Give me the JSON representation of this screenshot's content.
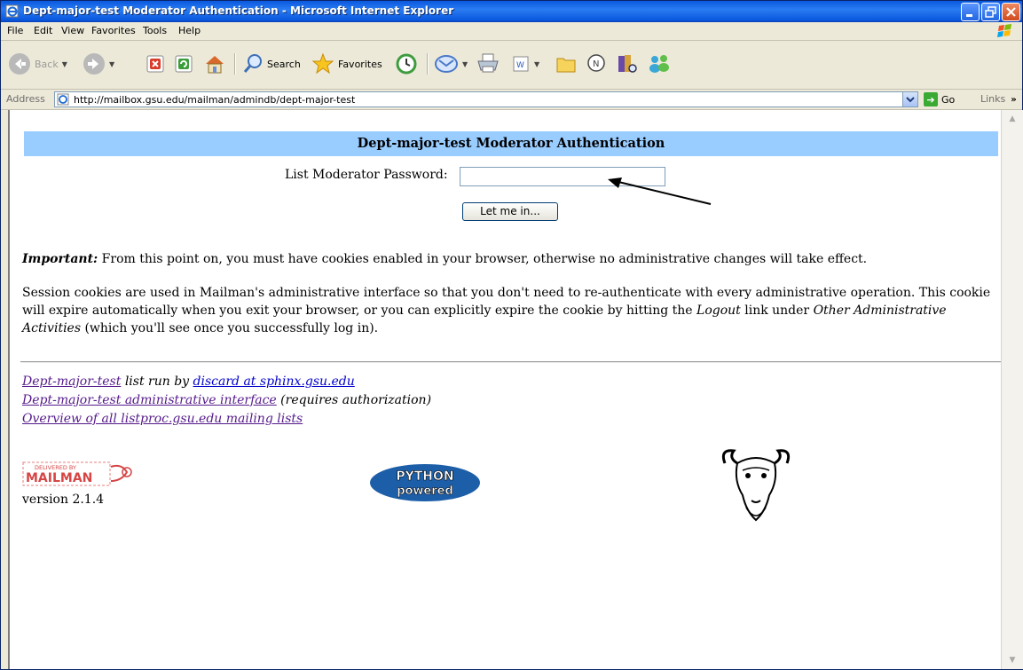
{
  "window": {
    "title": "Dept-major-test Moderator Authentication - Microsoft Internet Explorer"
  },
  "menu": [
    "File",
    "Edit",
    "View",
    "Favorites",
    "Tools",
    "Help"
  ],
  "toolbar": {
    "back": "Back",
    "search": "Search",
    "favorites": "Favorites"
  },
  "address": {
    "label": "Address",
    "url": "http://mailbox.gsu.edu/mailman/admindb/dept-major-test",
    "go": "Go",
    "links": "Links",
    "links_chevron": "»"
  },
  "page": {
    "heading": "Dept-major-test Moderator Authentication",
    "password_label": "List Moderator Password:",
    "password_value": "",
    "login_button": "Let me in...",
    "important_label": "Important:",
    "important_text": " From this point on, you must have cookies enabled in your browser, otherwise no administrative changes will take effect.",
    "session_part1": "Session cookies are used in Mailman's administrative interface so that you don't need to re-authenticate with every administrative operation. This cookie will expire automatically when you exit your browser, or you can explicitly expire the cookie by hitting the ",
    "session_logout": "Logout",
    "session_part2": " link under ",
    "session_other": "Other Administrative Activities",
    "session_part3": " (which you'll see once you successfully log in).",
    "footer": {
      "list_link": "Dept-major-test",
      "run_by": " list run by ",
      "owner_link": "discard at sphinx.gsu.edu",
      "admin_link": "Dept-major-test administrative interface",
      "admin_note": " (requires authorization)",
      "overview_link": "Overview of all listproc.gsu.edu mailing lists"
    },
    "mailman_logo_top": "DELIVERED BY",
    "mailman_logo_main": "MAILMAN",
    "version": "version 2.1.4",
    "python_logo_top": "PYTHON",
    "python_logo_bottom": "powered"
  },
  "icons": {
    "title": "ie-page-icon",
    "back": "back-arrow-icon",
    "forward": "forward-arrow-icon",
    "stop": "stop-icon",
    "refresh": "refresh-icon",
    "home": "home-icon",
    "search": "search-icon",
    "favorites": "favorites-star-icon",
    "history": "history-icon",
    "mail": "mail-icon",
    "print": "print-icon",
    "edit": "edit-icon",
    "folder": "folder-icon",
    "messenger": "messenger-icon",
    "research": "research-icon",
    "people": "people-icon"
  },
  "colors": {
    "heading_bar": "#99ccff",
    "titlebar": "#0a58de",
    "visited_link": "#551a8b",
    "link": "#0000cc"
  }
}
